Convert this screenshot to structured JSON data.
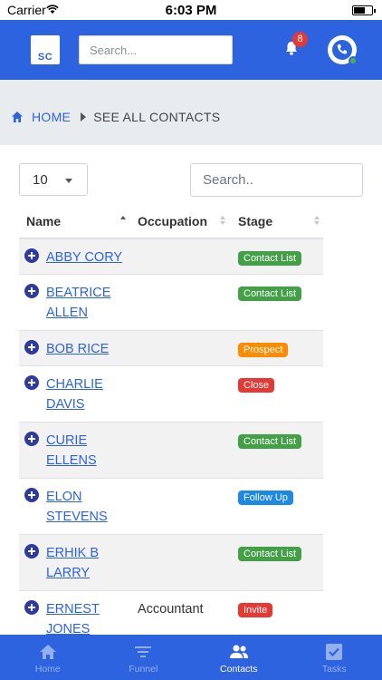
{
  "status_bar": {
    "carrier": "Carrier",
    "time": "6:03 PM"
  },
  "header": {
    "logo_text": "SC",
    "search_placeholder": "Search...",
    "notification_count": "8"
  },
  "breadcrumb": {
    "home": "HOME",
    "current": "SEE ALL CONTACTS"
  },
  "table_controls": {
    "page_size": "10",
    "search_placeholder": "Search.."
  },
  "table": {
    "columns": [
      "Name",
      "Occupation",
      "Stage"
    ],
    "rows": [
      {
        "name": "ABBY CORY",
        "occupation": "",
        "stage": "Contact List"
      },
      {
        "name": "BEATRICE ALLEN",
        "occupation": "",
        "stage": "Contact List"
      },
      {
        "name": "BOB RICE",
        "occupation": "",
        "stage": "Prospect"
      },
      {
        "name": "CHARLIE DAVIS",
        "occupation": "",
        "stage": "Close"
      },
      {
        "name": "CURIE ELLENS",
        "occupation": "",
        "stage": "Contact List"
      },
      {
        "name": "ELON STEVENS",
        "occupation": "",
        "stage": "Follow Up"
      },
      {
        "name": "ERHIK B LARRY",
        "occupation": "",
        "stage": "Contact List"
      },
      {
        "name": "ERNEST JONES",
        "occupation": "Accountant",
        "stage": "Invite"
      }
    ]
  },
  "stage_colors": {
    "Contact List": "#43a047",
    "Prospect": "#fb8c00",
    "Close": "#e53935",
    "Follow Up": "#1e88e5",
    "Invite": "#e53935"
  },
  "colors": {
    "primary": "#2e63e0",
    "plus_button": "#2e3b9e"
  },
  "bottom_nav": [
    {
      "label": "Home",
      "icon": "home-icon"
    },
    {
      "label": "Funnel",
      "icon": "funnel-icon"
    },
    {
      "label": "Contacts",
      "icon": "contacts-icon",
      "active": true
    },
    {
      "label": "Tasks",
      "icon": "tasks-icon"
    }
  ]
}
